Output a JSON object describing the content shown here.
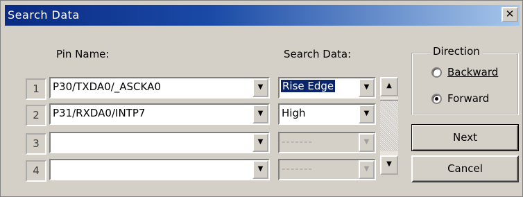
{
  "window": {
    "title": "Search Data",
    "close_label": "✕"
  },
  "columns": {
    "pin_name": "Pin Name:",
    "search_data": "Search Data:"
  },
  "rows": [
    {
      "num": "1",
      "pin": "P30/TXDA0/_ASCKA0",
      "search": "Rise Edge",
      "search_enabled": true,
      "selected": true
    },
    {
      "num": "2",
      "pin": "P31/RXDA0/INTP7",
      "search": "High",
      "search_enabled": true,
      "selected": false
    },
    {
      "num": "3",
      "pin": "",
      "search": "-------",
      "search_enabled": false,
      "selected": false
    },
    {
      "num": "4",
      "pin": "",
      "search": "-------",
      "search_enabled": false,
      "selected": false
    }
  ],
  "direction": {
    "title": "Direction",
    "backward_label": "Backward",
    "forward_label": "Forward",
    "selected": "Forward"
  },
  "buttons": {
    "next": "Next",
    "cancel": "Cancel"
  },
  "icons": {
    "dropdown": "chevron-down-icon",
    "scroll_up": "arrow-up-icon",
    "scroll_down": "arrow-down-icon"
  }
}
